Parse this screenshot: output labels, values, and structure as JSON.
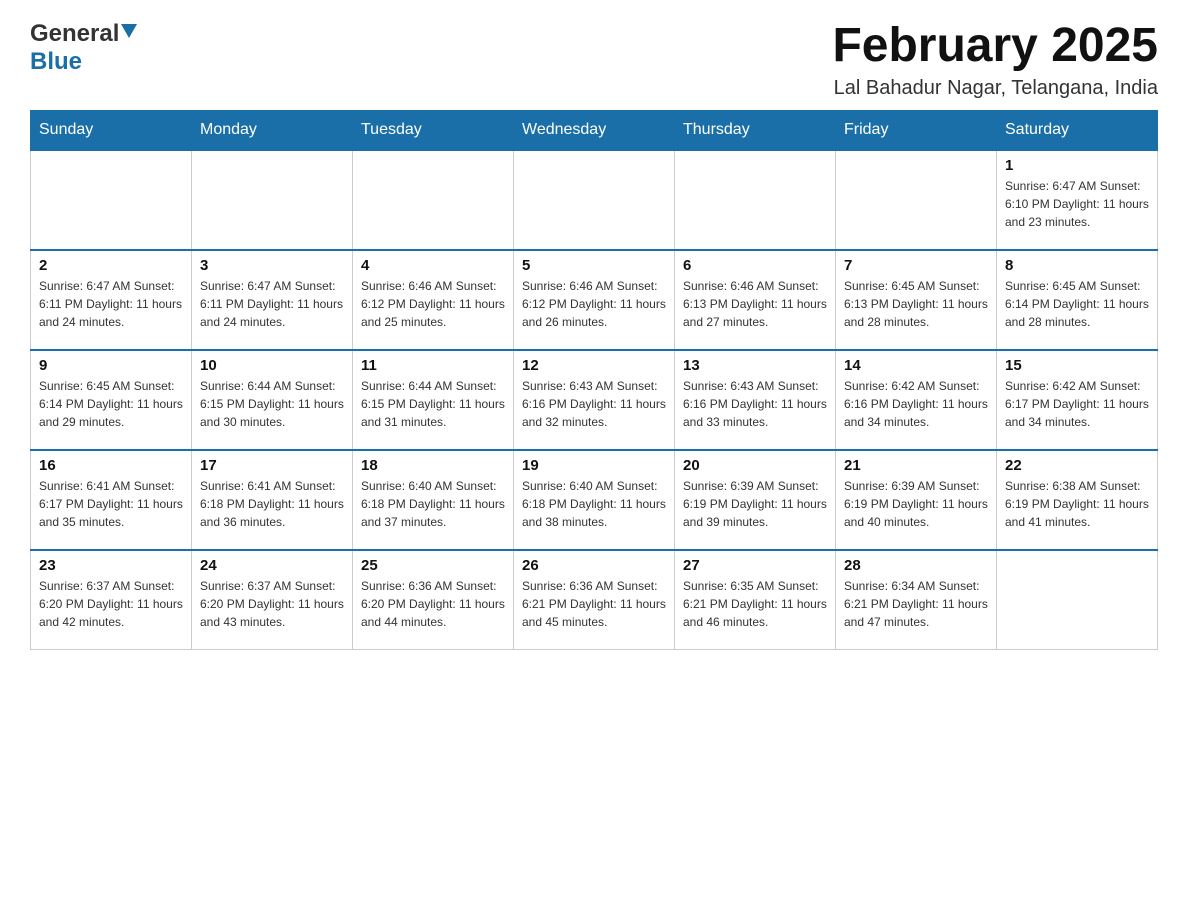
{
  "logo": {
    "general": "General",
    "blue": "Blue"
  },
  "header": {
    "month_year": "February 2025",
    "location": "Lal Bahadur Nagar, Telangana, India"
  },
  "weekdays": [
    "Sunday",
    "Monday",
    "Tuesday",
    "Wednesday",
    "Thursday",
    "Friday",
    "Saturday"
  ],
  "weeks": [
    [
      {
        "day": "",
        "info": ""
      },
      {
        "day": "",
        "info": ""
      },
      {
        "day": "",
        "info": ""
      },
      {
        "day": "",
        "info": ""
      },
      {
        "day": "",
        "info": ""
      },
      {
        "day": "",
        "info": ""
      },
      {
        "day": "1",
        "info": "Sunrise: 6:47 AM\nSunset: 6:10 PM\nDaylight: 11 hours and 23 minutes."
      }
    ],
    [
      {
        "day": "2",
        "info": "Sunrise: 6:47 AM\nSunset: 6:11 PM\nDaylight: 11 hours and 24 minutes."
      },
      {
        "day": "3",
        "info": "Sunrise: 6:47 AM\nSunset: 6:11 PM\nDaylight: 11 hours and 24 minutes."
      },
      {
        "day": "4",
        "info": "Sunrise: 6:46 AM\nSunset: 6:12 PM\nDaylight: 11 hours and 25 minutes."
      },
      {
        "day": "5",
        "info": "Sunrise: 6:46 AM\nSunset: 6:12 PM\nDaylight: 11 hours and 26 minutes."
      },
      {
        "day": "6",
        "info": "Sunrise: 6:46 AM\nSunset: 6:13 PM\nDaylight: 11 hours and 27 minutes."
      },
      {
        "day": "7",
        "info": "Sunrise: 6:45 AM\nSunset: 6:13 PM\nDaylight: 11 hours and 28 minutes."
      },
      {
        "day": "8",
        "info": "Sunrise: 6:45 AM\nSunset: 6:14 PM\nDaylight: 11 hours and 28 minutes."
      }
    ],
    [
      {
        "day": "9",
        "info": "Sunrise: 6:45 AM\nSunset: 6:14 PM\nDaylight: 11 hours and 29 minutes."
      },
      {
        "day": "10",
        "info": "Sunrise: 6:44 AM\nSunset: 6:15 PM\nDaylight: 11 hours and 30 minutes."
      },
      {
        "day": "11",
        "info": "Sunrise: 6:44 AM\nSunset: 6:15 PM\nDaylight: 11 hours and 31 minutes."
      },
      {
        "day": "12",
        "info": "Sunrise: 6:43 AM\nSunset: 6:16 PM\nDaylight: 11 hours and 32 minutes."
      },
      {
        "day": "13",
        "info": "Sunrise: 6:43 AM\nSunset: 6:16 PM\nDaylight: 11 hours and 33 minutes."
      },
      {
        "day": "14",
        "info": "Sunrise: 6:42 AM\nSunset: 6:16 PM\nDaylight: 11 hours and 34 minutes."
      },
      {
        "day": "15",
        "info": "Sunrise: 6:42 AM\nSunset: 6:17 PM\nDaylight: 11 hours and 34 minutes."
      }
    ],
    [
      {
        "day": "16",
        "info": "Sunrise: 6:41 AM\nSunset: 6:17 PM\nDaylight: 11 hours and 35 minutes."
      },
      {
        "day": "17",
        "info": "Sunrise: 6:41 AM\nSunset: 6:18 PM\nDaylight: 11 hours and 36 minutes."
      },
      {
        "day": "18",
        "info": "Sunrise: 6:40 AM\nSunset: 6:18 PM\nDaylight: 11 hours and 37 minutes."
      },
      {
        "day": "19",
        "info": "Sunrise: 6:40 AM\nSunset: 6:18 PM\nDaylight: 11 hours and 38 minutes."
      },
      {
        "day": "20",
        "info": "Sunrise: 6:39 AM\nSunset: 6:19 PM\nDaylight: 11 hours and 39 minutes."
      },
      {
        "day": "21",
        "info": "Sunrise: 6:39 AM\nSunset: 6:19 PM\nDaylight: 11 hours and 40 minutes."
      },
      {
        "day": "22",
        "info": "Sunrise: 6:38 AM\nSunset: 6:19 PM\nDaylight: 11 hours and 41 minutes."
      }
    ],
    [
      {
        "day": "23",
        "info": "Sunrise: 6:37 AM\nSunset: 6:20 PM\nDaylight: 11 hours and 42 minutes."
      },
      {
        "day": "24",
        "info": "Sunrise: 6:37 AM\nSunset: 6:20 PM\nDaylight: 11 hours and 43 minutes."
      },
      {
        "day": "25",
        "info": "Sunrise: 6:36 AM\nSunset: 6:20 PM\nDaylight: 11 hours and 44 minutes."
      },
      {
        "day": "26",
        "info": "Sunrise: 6:36 AM\nSunset: 6:21 PM\nDaylight: 11 hours and 45 minutes."
      },
      {
        "day": "27",
        "info": "Sunrise: 6:35 AM\nSunset: 6:21 PM\nDaylight: 11 hours and 46 minutes."
      },
      {
        "day": "28",
        "info": "Sunrise: 6:34 AM\nSunset: 6:21 PM\nDaylight: 11 hours and 47 minutes."
      },
      {
        "day": "",
        "info": ""
      }
    ]
  ]
}
